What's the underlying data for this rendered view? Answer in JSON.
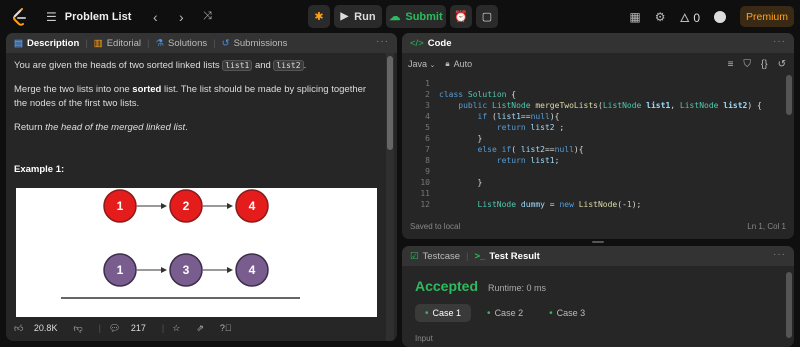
{
  "topbar": {
    "problem_list_label": "Problem List",
    "run_label": "Run",
    "submit_label": "Submit",
    "streak_count": "0",
    "premium_label": "Premium"
  },
  "description": {
    "tabs": [
      {
        "label": "Description"
      },
      {
        "label": "Editorial"
      },
      {
        "label": "Solutions"
      },
      {
        "label": "Submissions"
      }
    ],
    "p1_before": "You are given the heads of two sorted linked lists ",
    "code1": "list1",
    "p1_and": " and ",
    "code2": "list2",
    "p1_after": ".",
    "p2_before": "Merge the two lists into one ",
    "p2_bold": "sorted",
    "p2_after": " list. The list should be made by splicing together the nodes of the first two lists.",
    "p3_before": "Return ",
    "p3_italic": "the head of the merged linked list",
    "p3_after": ".",
    "example_title": "Example 1:",
    "list_a": [
      "1",
      "2",
      "4"
    ],
    "list_b": [
      "1",
      "3",
      "4"
    ],
    "colors": {
      "red_node": "#e41c1c",
      "purple_node": "#7a5d8f"
    }
  },
  "footer": {
    "likes": "20.8K",
    "comments": "217"
  },
  "code_panel": {
    "title": "Code",
    "language": "Java",
    "mode": "Auto",
    "status": "Saved to local",
    "cursor": "Ln 1, Col 1"
  },
  "testcase_panel": {
    "tab_testcase": "Testcase",
    "tab_result": "Test Result",
    "result": "Accepted",
    "runtime": "Runtime: 0 ms",
    "cases": [
      "Case 1",
      "Case 2",
      "Case 3"
    ],
    "input_label": "Input"
  },
  "accent": {
    "green": "#2cbb5d",
    "orange": "#ffa116"
  }
}
